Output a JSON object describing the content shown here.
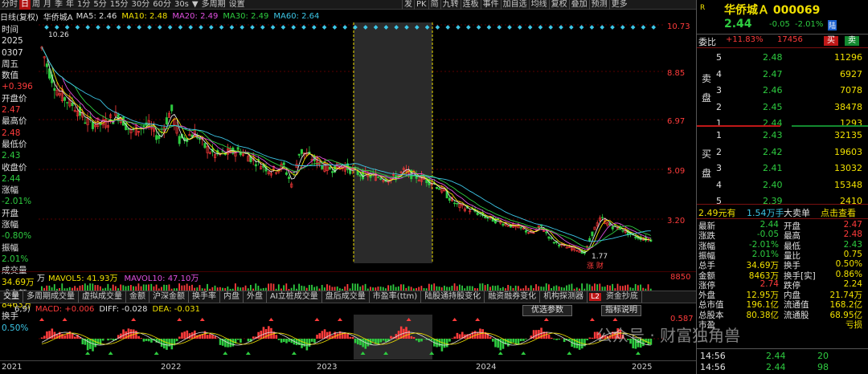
{
  "toolbar": {
    "items": [
      "分时",
      "日",
      "周",
      "月",
      "季",
      "年",
      "1分",
      "5分",
      "15分",
      "30分",
      "60分",
      "30s",
      "▼",
      "多周期",
      "设置"
    ],
    "active_index": 1,
    "right_items": [
      "发",
      "PK",
      "简",
      "九转",
      "连板",
      "事件",
      "加自选",
      "均线",
      "复权",
      "叠加",
      "预测",
      "更多"
    ]
  },
  "ma_line": {
    "prefix": "日线(复权)",
    "name": "华侨城A",
    "items": [
      {
        "label": "MA5: 2.46",
        "color": "#e0e0e0"
      },
      {
        "label": "MA10: 2.48",
        "color": "#f0e000"
      },
      {
        "label": "MA20: 2.49",
        "color": "#e050e0"
      },
      {
        "label": "MA30: 2.49",
        "color": "#2ecc40"
      },
      {
        "label": "MA60: 2.64",
        "color": "#3cc6e6"
      }
    ]
  },
  "left_col": [
    {
      "t": "时间",
      "c": "#e0e0e0"
    },
    {
      "t": "2025",
      "c": "#e0e0e0"
    },
    {
      "t": "0307",
      "c": "#e0e0e0"
    },
    {
      "t": "周五",
      "c": "#e0e0e0"
    },
    {
      "t": "数值",
      "c": "#e0e0e0"
    },
    {
      "t": "+0.396",
      "c": "#ff3b3b"
    },
    {
      "t": "开盘价",
      "c": "#e0e0e0"
    },
    {
      "t": "2.47",
      "c": "#ff3b3b"
    },
    {
      "t": "最高价",
      "c": "#e0e0e0"
    },
    {
      "t": "2.48",
      "c": "#ff3b3b"
    },
    {
      "t": "最低价",
      "c": "#e0e0e0"
    },
    {
      "t": "2.43",
      "c": "#2ecc40"
    },
    {
      "t": "收盘价",
      "c": "#e0e0e0"
    },
    {
      "t": "2.44",
      "c": "#2ecc40"
    },
    {
      "t": "涨幅",
      "c": "#e0e0e0"
    },
    {
      "t": "-2.01%",
      "c": "#2ecc40"
    },
    {
      "t": "开盘",
      "c": "#e0e0e0"
    },
    {
      "t": "涨幅",
      "c": "#e0e0e0"
    },
    {
      "t": "-0.80%",
      "c": "#2ecc40"
    },
    {
      "t": "振幅",
      "c": "#e0e0e0"
    },
    {
      "t": "2.01%",
      "c": "#2ecc40"
    },
    {
      "t": "成交量",
      "c": "#e0e0e0"
    },
    {
      "t": "34.69万",
      "c": "#f0e000"
    },
    {
      "t": "成交额",
      "c": "#e0e0e0"
    },
    {
      "t": "8463万",
      "c": "#f0e000"
    },
    {
      "t": "换手",
      "c": "#e0e0e0"
    },
    {
      "t": "0.50%",
      "c": "#3cc6e6"
    }
  ],
  "price_axis": [
    "10.73",
    "8.85",
    "6.97",
    "5.09",
    "3.20"
  ],
  "chart_annotations": {
    "high": "10.26",
    "low": "1.77",
    "marker": "涨 财"
  },
  "volume_line": {
    "a": "万",
    "b": "MAVOL5: 41.93万",
    "c": "MAVOL10: 47.10万",
    "right": "8850"
  },
  "tabs": [
    "交量",
    "多周期成交量",
    "虚拟成交量",
    "金额",
    "沪深金额",
    "换手率",
    "内盘",
    "外盘",
    "AI立桩成交量",
    "盘后成交量",
    "市盈率(ttm)",
    "陆股通持股变化",
    "融资融券变化",
    "机构探测器",
    "资金抄底"
  ],
  "tab_badge": "L2",
  "param_buttons": [
    "优选参数",
    "指标说明"
  ],
  "macd_line": {
    "prefix": "6,9)",
    "macd": "MACD: +0.006",
    "diff": "DIFF: -0.028",
    "dea": "DEA: -0.031"
  },
  "macd_axis": [
    "0.587"
  ],
  "x_axis": [
    "2021",
    "2022",
    "2023",
    "2024",
    "2025"
  ],
  "right_panel": {
    "title": "华侨城Ａ 000069",
    "price": "2.44",
    "change": "-0.05",
    "pct": "-2.01%",
    "tag": "陆",
    "weibi_label": "委比",
    "weibi_value": "+11.83%",
    "weibi_diff": "17456",
    "buy_btn": "买",
    "sell_btn": "卖",
    "sell_label": [
      "卖",
      "盘"
    ],
    "buy_label": [
      "买",
      "盘"
    ],
    "asks": [
      {
        "lv": "5",
        "p": "2.48",
        "v": "11296"
      },
      {
        "lv": "4",
        "p": "2.47",
        "v": "6927"
      },
      {
        "lv": "3",
        "p": "2.46",
        "v": "7078"
      },
      {
        "lv": "2",
        "p": "2.45",
        "v": "38478"
      },
      {
        "lv": "1",
        "p": "2.44",
        "v": "1293"
      }
    ],
    "bids": [
      {
        "lv": "1",
        "p": "2.43",
        "v": "32135"
      },
      {
        "lv": "2",
        "p": "2.42",
        "v": "19603"
      },
      {
        "lv": "3",
        "p": "2.41",
        "v": "13032"
      },
      {
        "lv": "4",
        "p": "2.40",
        "v": "15348"
      },
      {
        "lv": "5",
        "p": "2.39",
        "v": "2410"
      }
    ],
    "bigorder": {
      "a": "2.49元有",
      "b": "1.54万手",
      "c": "大卖单",
      "d": "点击查看"
    },
    "stats": [
      [
        "最新",
        "2.44",
        "开盘",
        "2.47"
      ],
      [
        "涨跌",
        "-0.05",
        "最高",
        "2.48"
      ],
      [
        "涨幅",
        "-2.01%",
        "最低",
        "2.43"
      ],
      [
        "振幅",
        "2.01%",
        "量比",
        "0.75"
      ],
      [
        "总手",
        "34.69万",
        "换手",
        "0.50%"
      ],
      [
        "金额",
        "8463万",
        "换手[实]",
        "0.86%"
      ],
      [
        "涨停",
        "2.74",
        "跌停",
        "2.24"
      ],
      [
        "外盘",
        "12.95万",
        "内盘",
        "21.74万"
      ],
      [
        "总市值",
        "196.1亿",
        "流通值",
        "168.2亿"
      ],
      [
        "总股本",
        "80.38亿",
        "流通股",
        "68.95亿"
      ],
      [
        "市盈",
        "",
        "",
        "亏损"
      ]
    ],
    "ticks": [
      {
        "t": "14:56",
        "p": "2.44",
        "v": "20"
      },
      {
        "t": "14:56",
        "p": "2.44",
        "v": "98"
      }
    ]
  },
  "watermark": "公众号 · 财富独角兽"
}
